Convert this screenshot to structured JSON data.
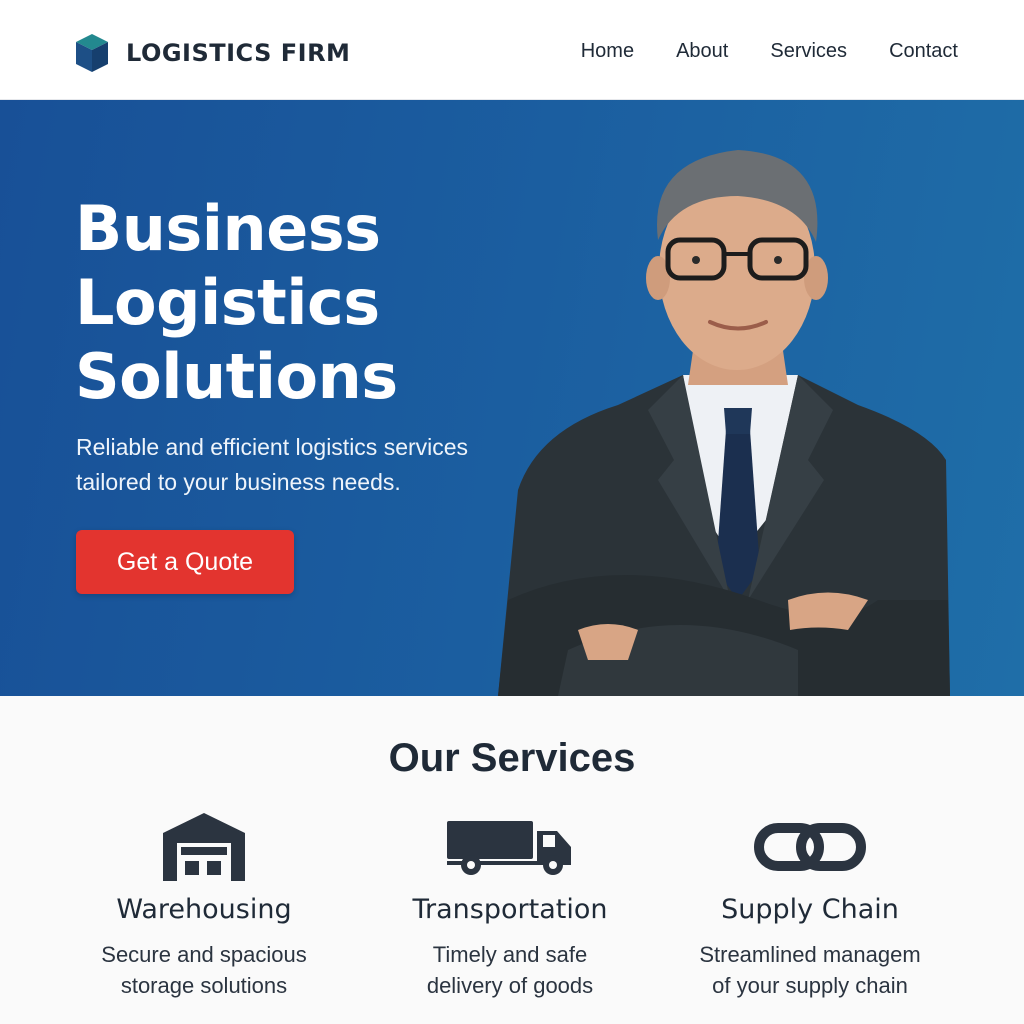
{
  "header": {
    "brand_name": "LOGISTICS FIRM",
    "nav": [
      {
        "label": "Home"
      },
      {
        "label": "About"
      },
      {
        "label": "Services"
      },
      {
        "label": "Contact"
      }
    ]
  },
  "hero": {
    "title": "Business Logistics Solutions",
    "subtitle": "Reliable and efficient logistics services tailored to your business needs.",
    "cta_label": "Get a Quote"
  },
  "services": {
    "title": "Our Services",
    "items": [
      {
        "icon": "warehouse-icon",
        "name": "Warehousing",
        "description": "Secure and spacious\nstorage solutions"
      },
      {
        "icon": "truck-icon",
        "name": "Transportation",
        "description": "Timely and safe\ndelivery of goods"
      },
      {
        "icon": "chain-link-icon",
        "name": "Supply Chain",
        "description": "Streamlined managem\nof your supply chain"
      }
    ]
  },
  "colors": {
    "hero_blue": "#1b5ea0",
    "cta_red": "#e3342f",
    "logo_teal": "#1e7f86",
    "icon_dark": "#2b3440"
  }
}
